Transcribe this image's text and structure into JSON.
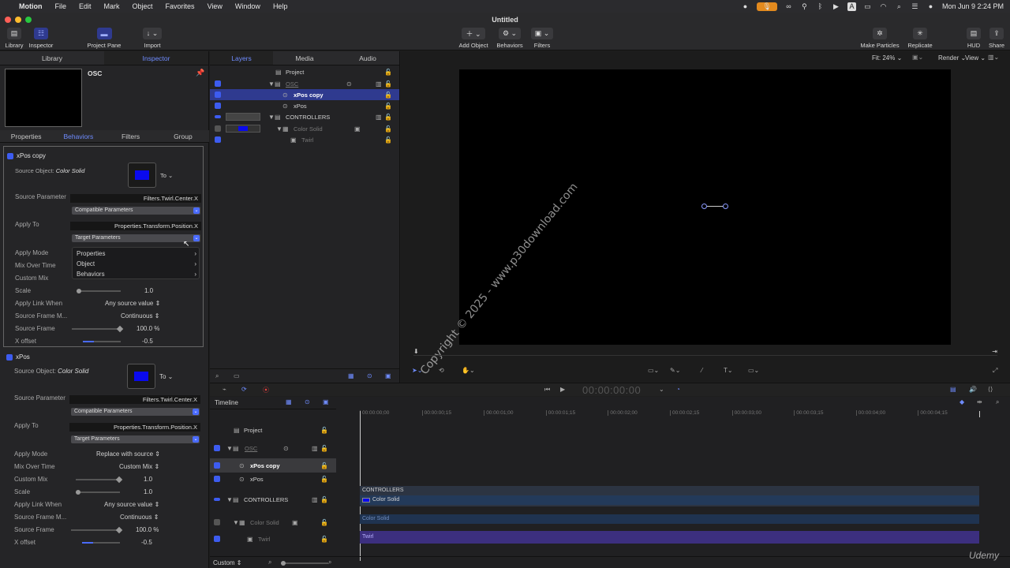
{
  "menubar": {
    "app": "Motion",
    "items": [
      "File",
      "Edit",
      "Mark",
      "Object",
      "Favorites",
      "View",
      "Window",
      "Help"
    ],
    "clock": "Mon Jun 9  2:24 PM"
  },
  "window": {
    "title": "Untitled"
  },
  "toolbar": {
    "library": "Library",
    "inspector": "Inspector",
    "project_pane": "Project Pane",
    "import": "Import",
    "add_object": "Add Object",
    "behaviors": "Behaviors",
    "filters": "Filters",
    "make_particles": "Make Particles",
    "replicate": "Replicate",
    "hud": "HUD",
    "share": "Share"
  },
  "left_tabs": {
    "library": "Library",
    "inspector": "Inspector"
  },
  "preview": {
    "name": "OSC"
  },
  "inspector_tabs": [
    "Properties",
    "Behaviors",
    "Filters",
    "Group"
  ],
  "behavior1": {
    "name": "xPos copy",
    "source_object_label": "Source Object:",
    "source_object_value": "Color Solid",
    "to": "To",
    "source_parameter_label": "Source Parameter",
    "source_parameter_value": "Filters.Twirl.Center.X",
    "compatible": "Compatible Parameters",
    "apply_to_label": "Apply To",
    "apply_to_value": "Properties.Transform.Position.X",
    "target": "Target Parameters",
    "apply_mode_label": "Apply Mode",
    "mix_over_time_label": "Mix Over Time",
    "custom_mix_label": "Custom Mix",
    "scale_label": "Scale",
    "scale_value": "1.0",
    "apply_link_label": "Apply Link When",
    "apply_link_value": "Any source value",
    "source_frame_m_label": "Source Frame M...",
    "source_frame_m_value": "Continuous",
    "source_frame_label": "Source Frame",
    "source_frame_value": "100.0",
    "pct": "%",
    "x_offset_label": "X offset",
    "x_offset_value": "-0.5"
  },
  "dropdown": {
    "items": [
      "Properties",
      "Object",
      "Behaviors"
    ]
  },
  "behavior2": {
    "name": "xPos",
    "source_object_label": "Source Object:",
    "source_object_value": "Color Solid",
    "to": "To",
    "source_parameter_label": "Source Parameter",
    "source_parameter_value": "Filters.Twirl.Center.X",
    "compatible": "Compatible Parameters",
    "apply_to_label": "Apply To",
    "apply_to_value": "Properties.Transform.Position.X",
    "target": "Target Parameters",
    "apply_mode_label": "Apply Mode",
    "apply_mode_value": "Replace with source",
    "mix_over_time_label": "Mix Over Time",
    "mix_over_time_value": "Custom Mix",
    "custom_mix_label": "Custom Mix",
    "custom_mix_value": "1.0",
    "scale_label": "Scale",
    "scale_value": "1.0",
    "apply_link_label": "Apply Link When",
    "apply_link_value": "Any source value",
    "source_frame_m_label": "Source Frame M...",
    "source_frame_m_value": "Continuous",
    "source_frame_label": "Source Frame",
    "source_frame_value": "100.0",
    "pct": "%",
    "x_offset_label": "X offset",
    "x_offset_value": "-0.5"
  },
  "layers_tabs": [
    "Layers",
    "Media",
    "Audio"
  ],
  "layers": {
    "project": "Project",
    "osc": "OSC",
    "xpos_copy": "xPos copy",
    "xpos": "xPos",
    "controllers": "CONTROLLERS",
    "color_solid": "Color Solid",
    "twirl": "Twirl"
  },
  "canvas_bar": {
    "fit": "Fit: 24%",
    "render": "Render",
    "view": "View"
  },
  "watermark": "Copyright © 2025 - www.p30download.com",
  "transport": {
    "timecode": "00:00:00:00"
  },
  "timeline": {
    "title": "Timeline",
    "ruler": [
      "00:00:00;00",
      "00:00:00;15",
      "00:00:01;00",
      "00:00:01;15",
      "00:00:02;00",
      "00:00:02;15",
      "00:00:03;00",
      "00:00:03;15",
      "00:00:04;00",
      "00:00:04;15"
    ],
    "tracks": {
      "project": "Project",
      "osc": "OSC",
      "xpos_copy": "xPos copy",
      "xpos": "xPos",
      "controllers": "CONTROLLERS",
      "color_solid": "Color Solid",
      "twirl": "Twirl"
    },
    "bars": {
      "controllers": "CONTROLLERS",
      "color_solid_a": "Color Solid",
      "color_solid_b": "Color Solid",
      "twirl": "Twirl"
    },
    "zoom_mode": "Custom"
  },
  "brand": "Udemy",
  "colors": {
    "accent": "#6f8cff",
    "selection": "#2f3a8f",
    "solid_blue": "#0a0aee"
  }
}
